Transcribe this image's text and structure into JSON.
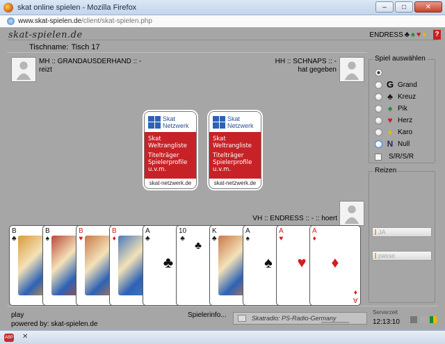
{
  "window": {
    "title": "skat online spielen - Mozilla Firefox"
  },
  "browser": {
    "url_domain": "www.skat-spielen.de",
    "url_path": "/client/skat-spielen.php"
  },
  "app": {
    "logo": "skat-spielen.de",
    "user": "ENDRESS",
    "help": "?",
    "tischname_label": "Tischname:",
    "tischname_value": "Tisch 17"
  },
  "players": {
    "left": {
      "line1": "MH :: GRANDAUSDERHAND :: -",
      "line2": "reizt"
    },
    "right": {
      "line1": "HH :: SCHNAPS :: -",
      "line2": "hat gegeben"
    },
    "me": {
      "line1": "VH :: ENDRESS :: - :: hoert"
    }
  },
  "promo": {
    "brand1": "Skat",
    "brand2": "Netzwerk",
    "line1": "Skat",
    "line2": "Weltrangliste",
    "line3": "Titelträger",
    "line4": "Spielerprofile",
    "line5": "u.v.m.",
    "footer": "skat-netzwerk.de"
  },
  "hand": [
    {
      "rank": "B",
      "suit": "♣",
      "color": "black"
    },
    {
      "rank": "B",
      "suit": "♠",
      "color": "black"
    },
    {
      "rank": "B",
      "suit": "♥",
      "color": "red"
    },
    {
      "rank": "B",
      "suit": "♦",
      "color": "red"
    },
    {
      "rank": "A",
      "suit": "♣",
      "color": "black"
    },
    {
      "rank": "10",
      "suit": "♣",
      "color": "black"
    },
    {
      "rank": "K",
      "suit": "♣",
      "color": "black"
    },
    {
      "rank": "A",
      "suit": "♠",
      "color": "black"
    },
    {
      "rank": "A",
      "suit": "♥",
      "color": "red"
    },
    {
      "rank": "A",
      "suit": "♦",
      "color": "red"
    }
  ],
  "spiel": {
    "legend": "Spiel auswählen",
    "options": [
      {
        "label": "",
        "icon": ""
      },
      {
        "label": "Grand",
        "icon": "G"
      },
      {
        "label": "Kreuz",
        "icon": "♣"
      },
      {
        "label": "Pik",
        "icon": "♠"
      },
      {
        "label": "Herz",
        "icon": "♥"
      },
      {
        "label": "Karo",
        "icon": "♦"
      },
      {
        "label": "Null",
        "icon": "N"
      }
    ],
    "srsr": "S/R/S/R"
  },
  "reizen": {
    "legend": "Reizen",
    "ja": "JA",
    "passe": "passe"
  },
  "bottom": {
    "play": "play",
    "powered": "powered by: skat-spielen.de",
    "spielerinfo": "Spielerinfo...",
    "radio": "Skatradio: PS-Radio-Germany",
    "serverzeit_label": "Serverzeit",
    "serverzeit": "12:13:10"
  },
  "colors": {
    "red": "#c72227",
    "blue": "#2d62b5",
    "table": "#a6a6a6"
  }
}
